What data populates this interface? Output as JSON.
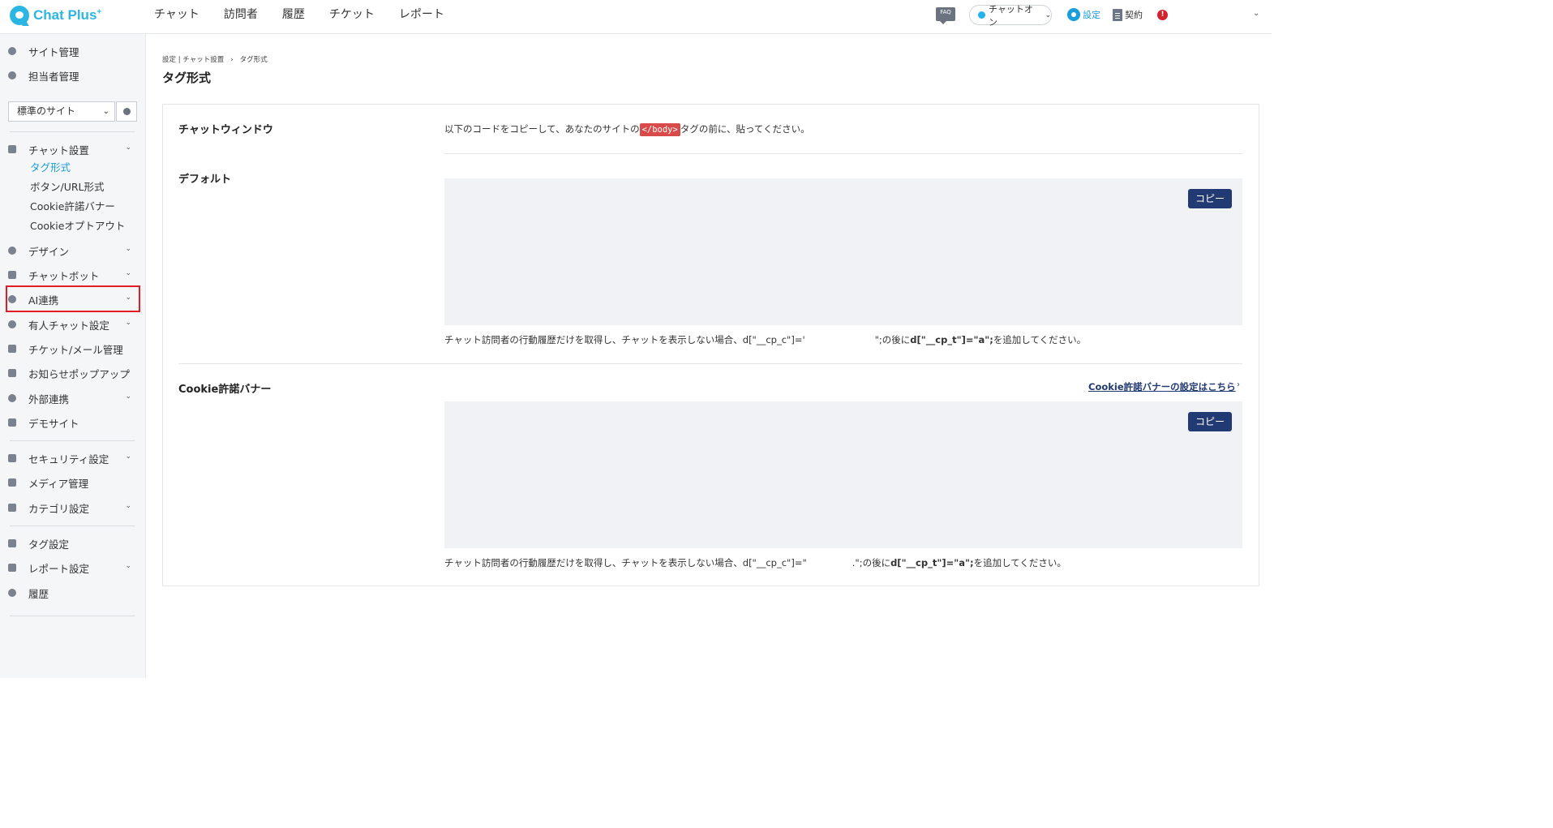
{
  "brand": {
    "name": "Chat Plus",
    "plus": "+"
  },
  "main_nav": [
    "チャット",
    "訪問者",
    "履歴",
    "チケット",
    "レポート"
  ],
  "header": {
    "faq": "FAQ",
    "status": "チャットオン",
    "settings": "設定",
    "contract": "契約",
    "alert": "!"
  },
  "sidebar": {
    "site_manage": "サイト管理",
    "staff_manage": "担当者管理",
    "site_select": "標準のサイト",
    "chat_setup": "チャット設置",
    "sub_items": [
      "タグ形式",
      "ボタン/URL形式",
      "Cookie許諾バナー",
      "Cookieオプトアウト"
    ],
    "design": "デザイン",
    "chatbot": "チャットボット",
    "ai": "AI連携",
    "manned_chat": "有人チャット設定",
    "ticket_mail": "チケット/メール管理",
    "popup": "お知らせポップアップ",
    "external": "外部連携",
    "demo": "デモサイト",
    "security": "セキュリティ設定",
    "media": "メディア管理",
    "category": "カテゴリ設定",
    "tag": "タグ設定",
    "report_settings": "レポート設定",
    "history": "履歴"
  },
  "breadcrumb": {
    "parent": "設定",
    "middle": "チャット設置",
    "current": "タグ形式"
  },
  "page_title": "タグ形式",
  "chat_window": {
    "title": "チャットウィンドウ",
    "desc_before": "以下のコードをコピーして、あなたのサイトの",
    "desc_tag": "</body>",
    "desc_after": "タグの前に、貼ってください。"
  },
  "default_section": {
    "title": "デフォルト",
    "copy": "コピー",
    "note_before": "チャット訪問者の行動履歴だけを取得し、チャットを表示しない場合、d[\"__cp_c\"]='",
    "note_mid": "\";の後に",
    "note_code": "d[\"__cp_t\"]=\"a\";",
    "note_after": "を追加してください。"
  },
  "cookie_section": {
    "title": "Cookie許諾バナー",
    "link": "Cookie許諾バナーの設定はこちら",
    "copy": "コピー",
    "note_before": "チャット訪問者の行動履歴だけを取得し、チャットを表示しない場合、d[\"__cp_c\"]=\"",
    "note_mid": ".\";の後に",
    "note_code": "d[\"__cp_t\"]=\"a\";",
    "note_after": "を追加してください。"
  },
  "colors": {
    "accent": "#1a9dd9",
    "button": "#223a73",
    "highlight": "#e01d24",
    "code_tag": "#d94a4a"
  }
}
